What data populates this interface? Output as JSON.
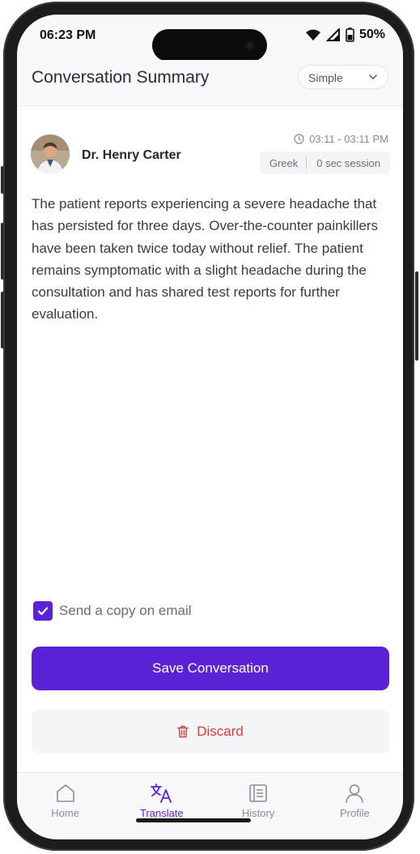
{
  "status_bar": {
    "time": "06:23 PM",
    "battery": "50%"
  },
  "header": {
    "title": "Conversation Summary",
    "mode_select": {
      "value": "Simple"
    }
  },
  "conversation": {
    "doctor_name": "Dr. Henry Carter",
    "time_range": "03:11 - 03:11 PM",
    "language": "Greek",
    "session": "0 sec session",
    "summary": "The patient reports experiencing a severe headache that has persisted for three days. Over-the-counter painkillers have been taken twice today without relief. The patient remains symptomatic with a slight headache during the consultation and has shared test reports for further evaluation."
  },
  "email_copy": {
    "label": "Send a copy on email",
    "checked": true
  },
  "actions": {
    "save_label": "Save Conversation",
    "discard_label": "Discard"
  },
  "tabbar": {
    "tabs": [
      {
        "label": "Home",
        "icon": "home-icon"
      },
      {
        "label": "Translate",
        "icon": "translate-icon",
        "active": true
      },
      {
        "label": "History",
        "icon": "history-icon"
      },
      {
        "label": "Profile",
        "icon": "profile-icon"
      }
    ]
  },
  "colors": {
    "accent": "#5b21d6",
    "danger": "#d63a3a"
  }
}
